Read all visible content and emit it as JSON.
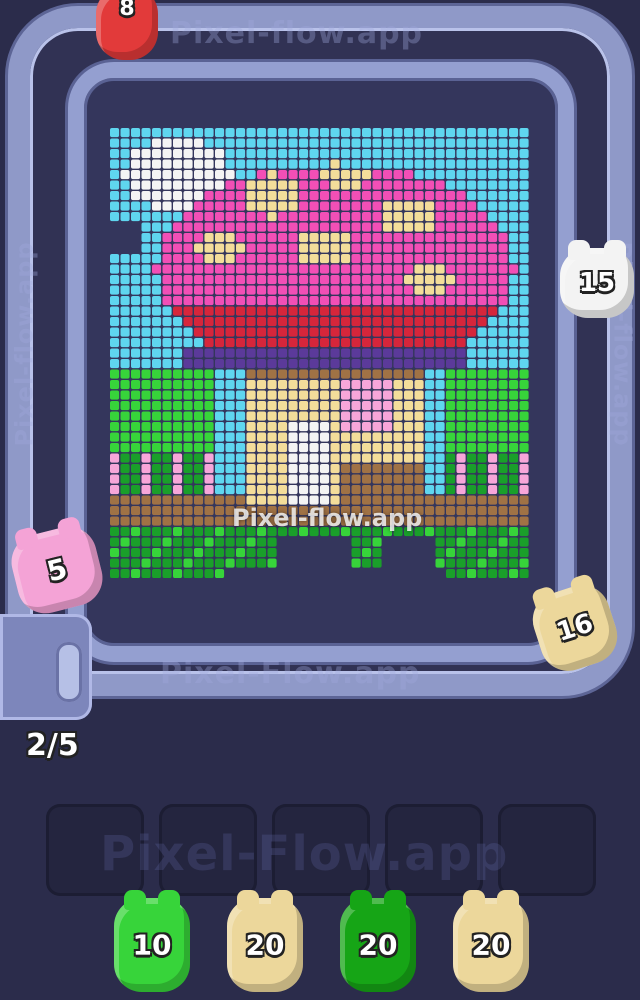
{
  "watermark": "Pixel-flow.app",
  "conveyor": {
    "bottom_text": "Pixel-Flow.app",
    "top_text": "Pixel-flow.app",
    "side_text": "Pixel-flow.app"
  },
  "conveyor_pigs": [
    {
      "color": "#e23a3a",
      "count": "8"
    },
    {
      "color": "#f3f3f3",
      "count": "15"
    },
    {
      "color": "#ecd79b",
      "count": "16"
    },
    {
      "color": "#f4a3d6",
      "count": "5"
    }
  ],
  "launcher_counter": "2/5",
  "slots_watermark": "Pixel-Flow.app",
  "queue": [
    {
      "color": "#37d43a",
      "count": "10"
    },
    {
      "color": "#ecd79b",
      "count": "20"
    },
    {
      "color": "#16a516",
      "count": "20"
    },
    {
      "color": "#ecd79b",
      "count": "20"
    }
  ],
  "slots_empty": 5,
  "board_colors": {
    "sky": "#5fd6ef",
    "white": "#f4f4f4",
    "pink": "#f24fb6",
    "light_pink": "#f7a6d9",
    "red": "#d6263b",
    "cream": "#f3dd9a",
    "brown": "#a07245",
    "green": "#37d43a",
    "dark_green": "#1a9f2a",
    "purple": "#5b3a9a",
    "black_bg": "#34365c"
  }
}
